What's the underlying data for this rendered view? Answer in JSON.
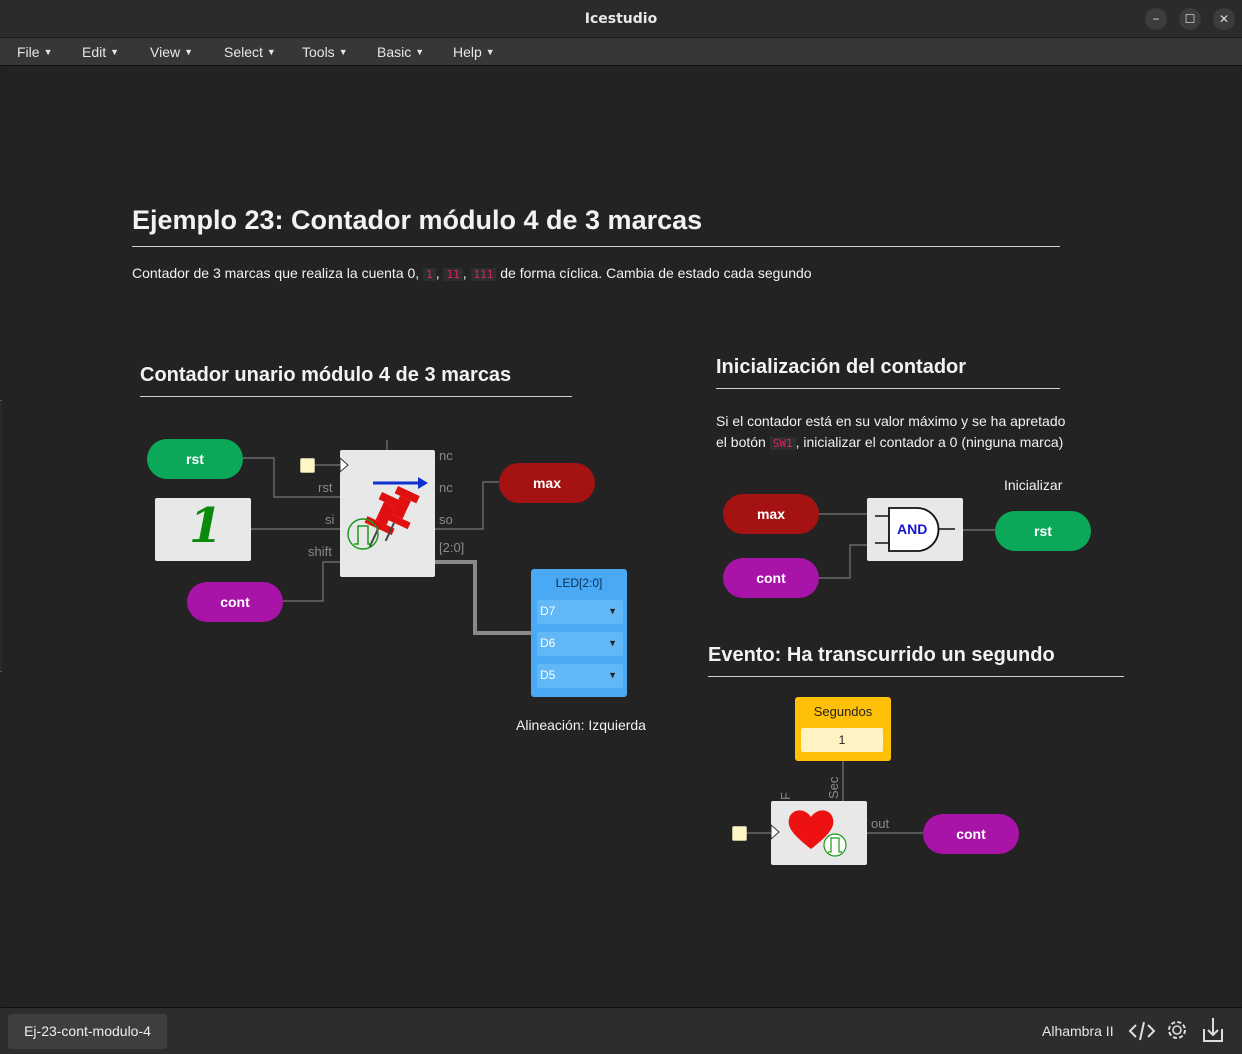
{
  "window": {
    "title": "Icestudio",
    "minimize": "−",
    "maximize": "☐",
    "close": "✕"
  },
  "menu": [
    {
      "label": "File"
    },
    {
      "label": "Edit"
    },
    {
      "label": "View"
    },
    {
      "label": "Select"
    },
    {
      "label": "Tools"
    },
    {
      "label": "Basic"
    },
    {
      "label": "Help"
    }
  ],
  "doc": {
    "title": "Ejemplo 23: Contador módulo 4 de 3 marcas",
    "desc_pre": "Contador de 3 marcas que realiza la cuenta 0,",
    "code1": "1",
    "code2": "11",
    "code3": "111",
    "desc_post": "de forma cíclica. Cambia de estado cada segundo",
    "sep": ","
  },
  "section_counter": {
    "title": "Contador unario módulo 4 de 3 marcas",
    "in_rst": "rst",
    "in_cont": "cont",
    "out_max": "max",
    "pins": {
      "rst": "rst",
      "si": "si",
      "shift": "shift",
      "nc1": "nc",
      "nc2": "nc",
      "so": "so",
      "bus": "[2:0]"
    },
    "const_one": "1",
    "led": {
      "title": "LED[2:0]",
      "rows": [
        "D7",
        "D6",
        "D5"
      ],
      "arrow": "▼"
    },
    "align_label": "Alineación: Izquierda"
  },
  "section_init": {
    "title": "Inicialización del contador",
    "line1": "Si el contador está en su valor máximo y se ha apretado",
    "line2_pre": "el botón",
    "code": "SW1",
    "line2_post": ", inicializar el contador a 0 (ninguna marca)",
    "block_label": "Inicializar",
    "in_max": "max",
    "in_cont": "cont",
    "gate": "AND",
    "out_rst": "rst"
  },
  "section_event": {
    "title": "Evento: Ha transcurrido un segundo",
    "const_title": "Segundos",
    "const_value": "1",
    "pin_f": "F",
    "pin_sec": "Sec",
    "pin_out": "out",
    "out_cont": "cont"
  },
  "footer": {
    "file": "Ej-23-cont-modulo-4",
    "board": "Alhambra II"
  },
  "colors": {
    "green": "#0ca85a",
    "red": "#a51212",
    "purple": "#a814a8",
    "led": "#49a9f5",
    "const": "#ffc107"
  }
}
